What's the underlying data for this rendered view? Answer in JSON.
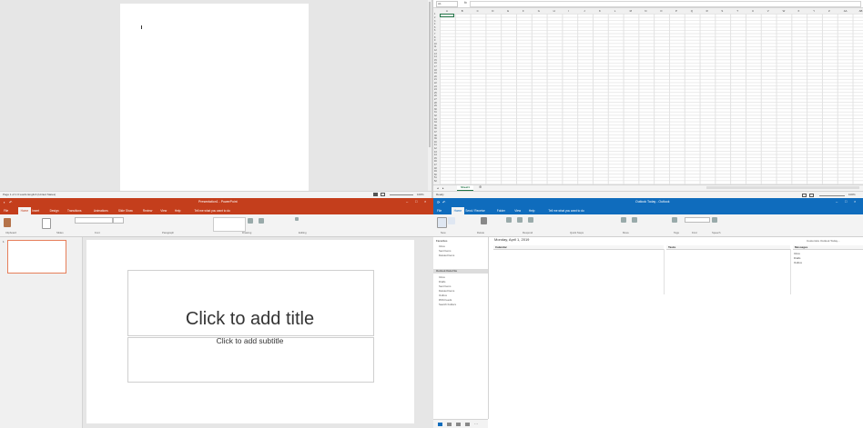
{
  "word": {
    "status_left": "Page 1 of 1   0 words   English (United States)",
    "zoom": "100%"
  },
  "excel": {
    "name_box": "A1",
    "columns": [
      "A",
      "B",
      "C",
      "D",
      "E",
      "F",
      "G",
      "H",
      "I",
      "J",
      "K",
      "L",
      "M",
      "N",
      "O",
      "P",
      "Q",
      "R",
      "S",
      "T",
      "U",
      "V",
      "W",
      "X",
      "Y",
      "Z",
      "AA",
      "AB"
    ],
    "rows": [
      "1",
      "2",
      "3",
      "4",
      "5",
      "6",
      "7",
      "8",
      "9",
      "10",
      "11",
      "12",
      "13",
      "14",
      "15",
      "16",
      "17",
      "18",
      "19",
      "20",
      "21",
      "22",
      "23",
      "24",
      "25",
      "26",
      "27",
      "28",
      "29",
      "30",
      "31",
      "32",
      "33",
      "34",
      "35",
      "36",
      "37",
      "38",
      "39",
      "40",
      "41",
      "42",
      "43",
      "44",
      "45",
      "46",
      "47",
      "48",
      "49",
      "50",
      "51",
      "52"
    ],
    "sheet_tab": "Sheet1",
    "status_left": "Ready",
    "zoom": "100%"
  },
  "powerpoint": {
    "window_title": "Presentation1 - PowerPoint",
    "tabs": [
      "File",
      "Home",
      "Insert",
      "Design",
      "Transitions",
      "Animations",
      "Slide Show",
      "Review",
      "View",
      "Help"
    ],
    "tell_me": "Tell me what you want to do",
    "groups": [
      "Clipboard",
      "Slides",
      "Font",
      "Paragraph",
      "Drawing",
      "Editing"
    ],
    "slide_number": "1",
    "title_placeholder": "Click to add title",
    "subtitle_placeholder": "Click to add subtitle"
  },
  "outlook": {
    "window_title": "Outlook Today - Outlook",
    "tabs": [
      "File",
      "Home",
      "Send / Receive",
      "Folder",
      "View",
      "Help"
    ],
    "tell_me": "Tell me what you want to do",
    "groups": [
      "New",
      "Delete",
      "Respond",
      "Quick Steps",
      "Move",
      "Tags",
      "Find",
      "Speech"
    ],
    "favorites_header": "Favorites",
    "favorites": [
      "Inbox",
      "Sent Items",
      "Deleted Items"
    ],
    "data_file_header": "Outlook Data File",
    "folders": [
      "Inbox",
      "Drafts",
      "Sent Items",
      "Deleted Items",
      "Outbox",
      "RSS Feeds",
      "Search Folders"
    ],
    "date": "Monday, April 1, 2019",
    "customize": "Customize Outlook Today...",
    "columns": [
      "Calendar",
      "Tasks",
      "Messages"
    ],
    "messages": [
      "Inbox",
      "Drafts",
      "Outbox"
    ]
  }
}
